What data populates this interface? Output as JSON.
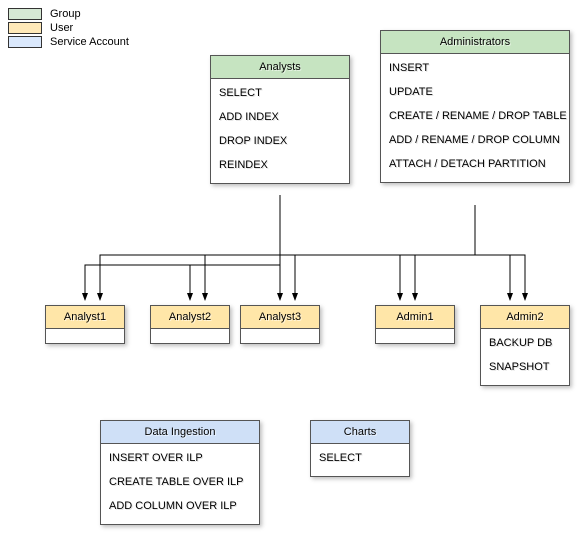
{
  "legend": {
    "group": "Group",
    "user": "User",
    "service": "Service Account"
  },
  "groups": {
    "analysts": {
      "title": "Analysts",
      "perms": [
        "SELECT",
        "ADD INDEX",
        "DROP INDEX",
        "REINDEX"
      ]
    },
    "admins": {
      "title": "Administrators",
      "perms": [
        "INSERT",
        "UPDATE",
        "CREATE / RENAME / DROP TABLE",
        "ADD / RENAME / DROP COLUMN",
        "ATTACH / DETACH PARTITION"
      ]
    }
  },
  "users": {
    "analyst1": {
      "title": "Analyst1",
      "perms": []
    },
    "analyst2": {
      "title": "Analyst2",
      "perms": []
    },
    "analyst3": {
      "title": "Analyst3",
      "perms": []
    },
    "admin1": {
      "title": "Admin1",
      "perms": []
    },
    "admin2": {
      "title": "Admin2",
      "perms": [
        "BACKUP DB",
        "SNAPSHOT"
      ]
    }
  },
  "services": {
    "ingestion": {
      "title": "Data Ingestion",
      "perms": [
        "INSERT OVER ILP",
        "CREATE TABLE OVER ILP",
        "ADD COLUMN OVER ILP"
      ]
    },
    "charts": {
      "title": "Charts",
      "perms": [
        "SELECT"
      ]
    }
  },
  "edges": [
    {
      "from": "analysts",
      "to": "analyst1"
    },
    {
      "from": "analysts",
      "to": "analyst2"
    },
    {
      "from": "analysts",
      "to": "analyst3"
    },
    {
      "from": "admins",
      "to": "analyst1"
    },
    {
      "from": "admins",
      "to": "analyst2"
    },
    {
      "from": "admins",
      "to": "analyst3"
    },
    {
      "from": "admins",
      "to": "admin1"
    },
    {
      "from": "admins",
      "to": "admin2"
    }
  ]
}
